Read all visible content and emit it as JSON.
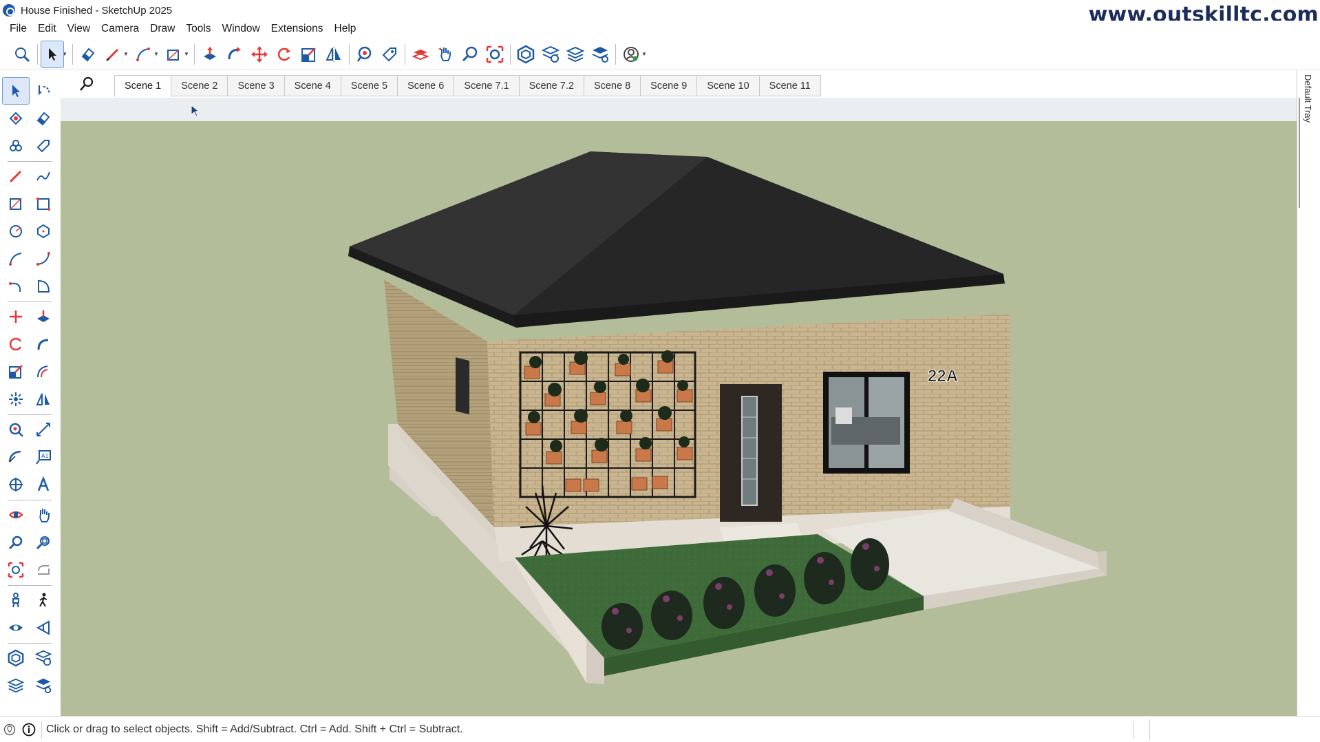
{
  "window": {
    "title": "House Finished - SketchUp 2025",
    "watermark": "www.outskilltc.com"
  },
  "menu": [
    "File",
    "Edit",
    "View",
    "Camera",
    "Draw",
    "Tools",
    "Window",
    "Extensions",
    "Help"
  ],
  "toolbar": {
    "icons": [
      "zoom-extents-icon",
      "select-icon",
      "eraser-icon",
      "pencil-icon",
      "line-icon",
      "rectangle-icon",
      "push-pull-icon",
      "follow-me-icon",
      "move-icon",
      "rotate-icon",
      "scale-icon",
      "flip-icon",
      "paint-bucket-icon",
      "tag-icon",
      "section-plane-icon",
      "pan-icon",
      "zoom-icon",
      "zoom-window-icon",
      "components-icon",
      "styles-icon",
      "layers-icon",
      "materials-icon",
      "account-icon"
    ]
  },
  "scenes": {
    "tabs": [
      "Scene 1",
      "Scene 2",
      "Scene 3",
      "Scene 4",
      "Scene 5",
      "Scene 6",
      "Scene 7.1",
      "Scene 7.2",
      "Scene 8",
      "Scene 9",
      "Scene 10",
      "Scene 11"
    ],
    "active": "Scene 1"
  },
  "tray": {
    "label": "Default Tray"
  },
  "model": {
    "house_number": "22A"
  },
  "status": {
    "text": "Click or drag to select objects. Shift = Add/Subtract. Ctrl = Add. Shift + Ctrl = Subtract."
  },
  "colors": {
    "viewport_bg": "#b3bd9a",
    "roof": "#2b2b2b",
    "brick": "#c9b58f",
    "grass": "#3f6b3a",
    "accent_red": "#e53935",
    "accent_blue": "#1c5aa6"
  }
}
